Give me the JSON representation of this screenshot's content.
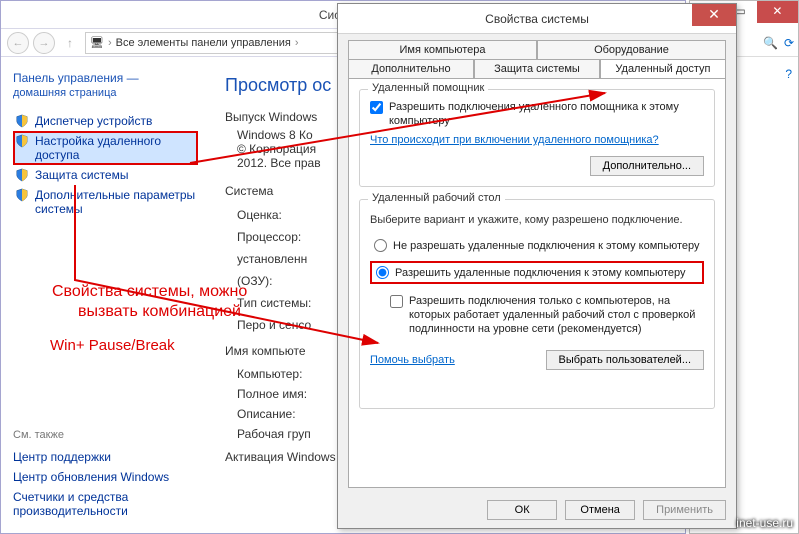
{
  "window": {
    "title": "Система",
    "breadcrumb": "Все элементы панели управления",
    "searchPlaceholder": "Поиск"
  },
  "sidebar": {
    "header": "Панель управления —",
    "subheader": "домашняя страница",
    "items": [
      {
        "label": "Диспетчер устройств"
      },
      {
        "label": "Настройка удаленного доступа"
      },
      {
        "label": "Защита системы"
      },
      {
        "label": "Дополнительные параметры системы"
      }
    ],
    "seeAlso": "См. также",
    "links": [
      "Центр поддержки",
      "Центр обновления Windows",
      "Счетчики и средства производительности"
    ]
  },
  "main": {
    "h1": "Просмотр ос",
    "editionHeader": "Выпуск Windows",
    "editionLine1": "Windows 8 Ко",
    "editionLine2": "© Корпорация",
    "editionLine3": "2012. Все прав",
    "systemHeader": "Система",
    "rows": {
      "rating": "Оценка:",
      "cpu": "Процессор:",
      "cpuNote": "установленн",
      "ram": "(ОЗУ):",
      "type": "Тип системы:",
      "pen": "Перо и сенсо",
      "nameHeader": "Имя компьюте",
      "computer": "Компьютер:",
      "fullname": "Полное имя:",
      "desc": "Описание:",
      "workgroup": "Рабочая груп",
      "activation": "Активация Windows"
    }
  },
  "dialog": {
    "title": "Свойства системы",
    "tabs": {
      "name": "Имя компьютера",
      "hw": "Оборудование",
      "adv": "Дополнительно",
      "prot": "Защита системы",
      "remote": "Удаленный доступ"
    },
    "assist": {
      "legend": "Удаленный помощник",
      "chk": "Разрешить подключения удаленного помощника к этому компьютеру",
      "link": "Что происходит при включении удаленного помощника?",
      "btn": "Дополнительно..."
    },
    "rdp": {
      "legend": "Удаленный рабочий стол",
      "hint": "Выберите вариант и укажите, кому разрешено подключение.",
      "opt1": "Не разрешать удаленные подключения к этому компьютеру",
      "opt2": "Разрешить удаленные подключения к этому компьютеру",
      "nla": "Разрешить подключения только с компьютеров, на которых работает удаленный рабочий стол с проверкой подлинности на уровне сети (рекомендуется)",
      "help": "Помочь выбрать",
      "users": "Выбрать пользователей..."
    },
    "buttons": {
      "ok": "ОК",
      "cancel": "Отмена",
      "apply": "Применить"
    }
  },
  "annotations": {
    "line1": "Свойства системы, можно",
    "line2": "вызвать комбинацией",
    "line3": "Win+ Pause/Break"
  },
  "watermark": "inet-use.ru"
}
